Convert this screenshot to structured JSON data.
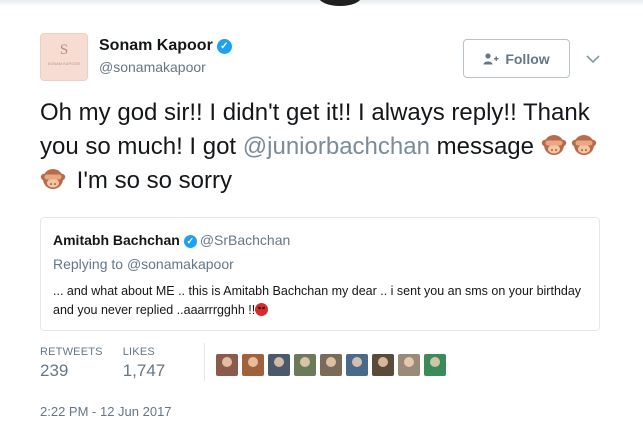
{
  "author": {
    "avatar_monogram": "S",
    "avatar_brand": "SONAM KAPOOR",
    "name": "Sonam Kapoor",
    "handle": "@sonamakapoor",
    "verified": true
  },
  "follow_label": "Follow",
  "tweet": {
    "text_part1": "Oh my god sir!! I didn't get it!! I always reply!! Thank you so much! I got ",
    "mention": "@juniorbachchan",
    "text_part2": " message ",
    "emoji": [
      "see-no-evil-monkey-icon",
      "see-no-evil-monkey-icon",
      "see-no-evil-monkey-icon"
    ],
    "text_part3": " I'm so so sorry"
  },
  "quoted_tweet": {
    "name": "Amitabh Bachchan",
    "handle": "@SrBachchan",
    "verified": true,
    "replying_prefix": "Replying to ",
    "replying_to": "@sonamakapoor",
    "text": "... and what about ME .. this is Amitabh Bachchan my dear .. i sent you an sms on your birthday and you never replied ..aaarrrgghh !!"
  },
  "stats": {
    "retweets_label": "RETWEETS",
    "retweets_value": "239",
    "likes_label": "LIKES",
    "likes_value": "1,747"
  },
  "likers": [
    "#8a5a4a",
    "#a0623c",
    "#4a5a6a",
    "#6a7a5a",
    "#7a6a5a",
    "#4a6a8a",
    "#5a4a3a",
    "#9a8a7a",
    "#3a8a5a"
  ],
  "timestamp": "2:22 PM - 12 Jun 2017",
  "colors": {
    "link_gray": "#7b8c98",
    "verified_blue": "#1da1f2",
    "secondary_text": "#657786",
    "border": "#e1e8ed"
  }
}
